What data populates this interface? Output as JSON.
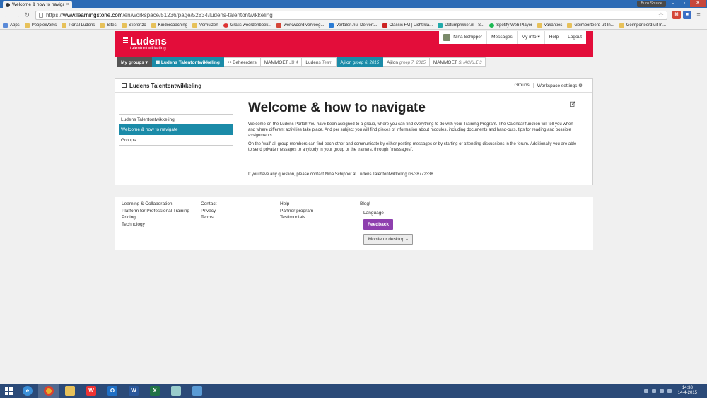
{
  "browser": {
    "tab_title": "Welcome & how to navigate",
    "tab_close": "×",
    "profile_badge": "Buro Source",
    "url_scheme": "https://",
    "url_domain": "www.learningstone.com",
    "url_path": "/en/workspace/51236/page/52834/ludens-talentontwikkeling",
    "bookmarks": [
      "Apps",
      "PeopleWorks",
      "Portal Ludens",
      "Sites",
      "Stiefenzo",
      "Kindercoaching",
      "Verhuizen",
      "Gratis woordenboek...",
      "werkwoord vervoeg...",
      "Vertalen.nu: De vert...",
      "Classic FM | Licht kla...",
      "Datumprikker.nl - S...",
      "Spotify Web Player",
      "vakanties",
      "Geimporteerd uit In...",
      "Geimporteerd uit In..."
    ]
  },
  "brand": {
    "name": "Ludens",
    "subtitle": "talentontwikkeling",
    "color": "#e30d3a"
  },
  "usermenu": {
    "user": "Nina Schipper",
    "messages": "Messages",
    "myinfo": "My info ▾",
    "help": "Help",
    "logout": "Logout"
  },
  "groupnav": {
    "mygroups": "My groups ▾",
    "current": "Ludens Talentontwikkeling",
    "beheerders": "Beheerders",
    "mammoet_jb": "MAMMOET",
    "mammoet_jb_sub": "JB 4",
    "ludens_team": "Ludens",
    "ludens_team_sub": "Team",
    "ajilon6": "Ajilon",
    "ajilon6_sub": "groep 6, 2015",
    "ajilon7": "Ajilon",
    "ajilon7_sub": "groep 7, 2015",
    "mammoet_sh": "MAMMOET",
    "mammoet_sh_sub": "SHACKLE 3"
  },
  "panel": {
    "title": "Ludens Talentontwikkeling",
    "groups_link": "Groups",
    "settings_link": "Workspace settings ⚙"
  },
  "leftnav": {
    "items": [
      "Ludens Talentontwikkeling",
      "Welcome & how to navigate",
      "Groups"
    ]
  },
  "content": {
    "title": "Welcome & how to navigate",
    "p1": "Welcome on the Ludens Portal! You have been assigned to a group, where you can find everything to do with your Training Program. The Calendar function will tell you when and where different activities take place. And per subject you will find pieces of information about modules, including documents and hand-outs, tips for reading and possible assignments.",
    "p2": "On the 'wall' all group members can find each other and communicate by either posting messages or by starting or attending discussions in the forum. Additionally you are able to send private messages to anybody in your group or the trainers, through \"messages\".",
    "p3": "If you have any question, please contact Nina Schipper at Ludens Talentontwikkeling 06-38772338"
  },
  "footer": {
    "col1": [
      "Learning & Collaboration",
      "Platform for Professional Training",
      "Pricing",
      "Technology"
    ],
    "col2": [
      "Contact",
      "Privacy",
      "Terms"
    ],
    "col3": [
      "Help",
      "Partner program",
      "Testimonials"
    ],
    "col4": [
      "Blog!"
    ],
    "language_label": "Language",
    "feedback": "Feedback",
    "mobile_toggle": "Mobile or desktop ▴"
  },
  "taskbar": {
    "time": "14:38",
    "date": "14-4-2015"
  }
}
